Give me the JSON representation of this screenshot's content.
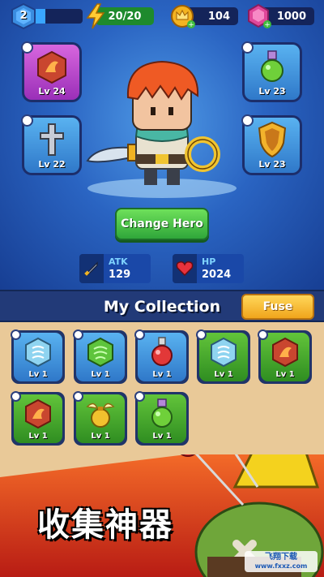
{
  "topbar": {
    "player_level": "2",
    "xp_progress": 0.25,
    "energy": "20/20",
    "coins": "104",
    "gems": "1000"
  },
  "equipment": {
    "left": [
      {
        "name": "Fire Sigil",
        "level": "Lv 24",
        "frame": "purple",
        "icon": "fire-rune-icon"
      },
      {
        "name": "Holy Cross",
        "level": "Lv 22",
        "frame": "blue",
        "icon": "cross-icon"
      }
    ],
    "right": [
      {
        "name": "Green Potion",
        "level": "Lv 23",
        "frame": "blue",
        "icon": "potion-icon"
      },
      {
        "name": "Golden Shield",
        "level": "Lv 23",
        "frame": "blue",
        "icon": "shield-icon"
      }
    ]
  },
  "hero": {
    "change_label": "Change Hero"
  },
  "stats": {
    "atk_label": "ATK",
    "atk_value": "129",
    "hp_label": "HP",
    "hp_value": "2024"
  },
  "collection": {
    "title": "My Collection",
    "fuse_label": "Fuse",
    "items": [
      {
        "level": "Lv 1",
        "frame": "blue",
        "icon": "ice-rune-icon"
      },
      {
        "level": "Lv 1",
        "frame": "blue",
        "icon": "wind-rune-icon"
      },
      {
        "level": "Lv 1",
        "frame": "blue",
        "icon": "red-potion-icon"
      },
      {
        "level": "Lv 1",
        "frame": "green",
        "icon": "ice-rune-icon"
      },
      {
        "level": "Lv 1",
        "frame": "green",
        "icon": "fire-rune-icon"
      },
      {
        "level": "Lv 1",
        "frame": "green",
        "icon": "fire-rune-icon"
      },
      {
        "level": "Lv 1",
        "frame": "green",
        "icon": "winged-pouch-icon"
      },
      {
        "level": "Lv 1",
        "frame": "green",
        "icon": "green-potion-icon"
      }
    ]
  },
  "banner": {
    "caption": "收集神器"
  },
  "watermark": {
    "line1": "飞翔下载",
    "line2": "www.fxxz.com"
  },
  "colors": {
    "accent_green": "#3fb84a",
    "accent_gold": "#f4b52a",
    "panel_blue": "#1d3f8a"
  }
}
